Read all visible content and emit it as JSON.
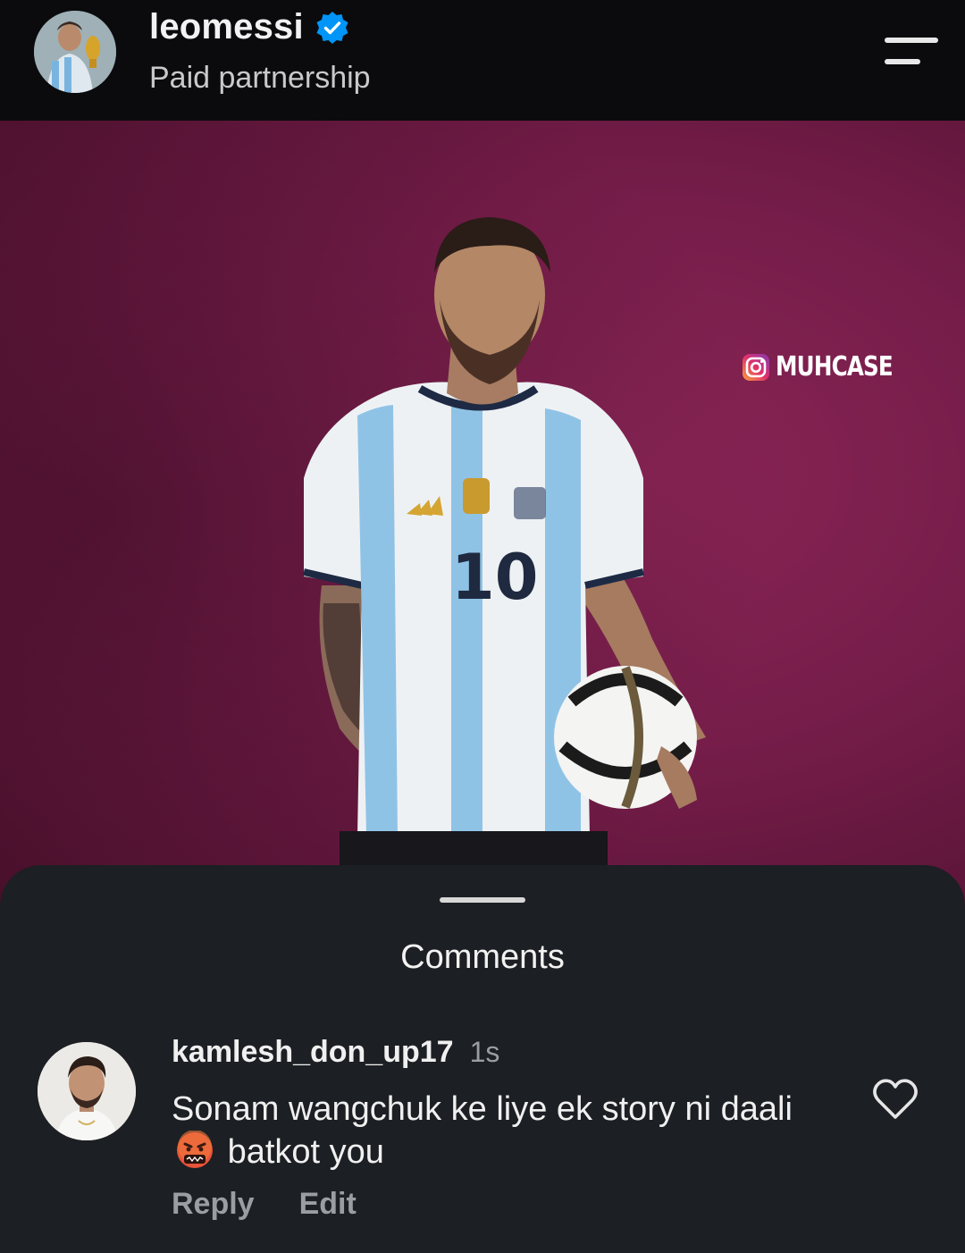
{
  "header": {
    "username": "leomessi",
    "verified": true,
    "subtitle": "Paid partnership",
    "menu_icon": "menu-lines-icon"
  },
  "post": {
    "watermark_text": "MUHCASE",
    "watermark_icon": "instagram-icon",
    "jersey_number": "10",
    "background_color": "#7a1f4d"
  },
  "comments_sheet": {
    "title": "Comments",
    "comment": {
      "username": "kamlesh_don_up17",
      "time": "1s",
      "text_before_emoji": "Sonam wangchuk ke liye ek story ni daali",
      "emoji": "face-with-symbols-on-mouth",
      "text_after_emoji": "batkot you",
      "reply_label": "Reply",
      "edit_label": "Edit",
      "like_icon": "heart-outline-icon"
    }
  },
  "colors": {
    "header_bg": "#0b0b0d",
    "sheet_bg": "#1c1f23",
    "verified_blue": "#0095f6",
    "muted_text": "#9a9ea3"
  }
}
